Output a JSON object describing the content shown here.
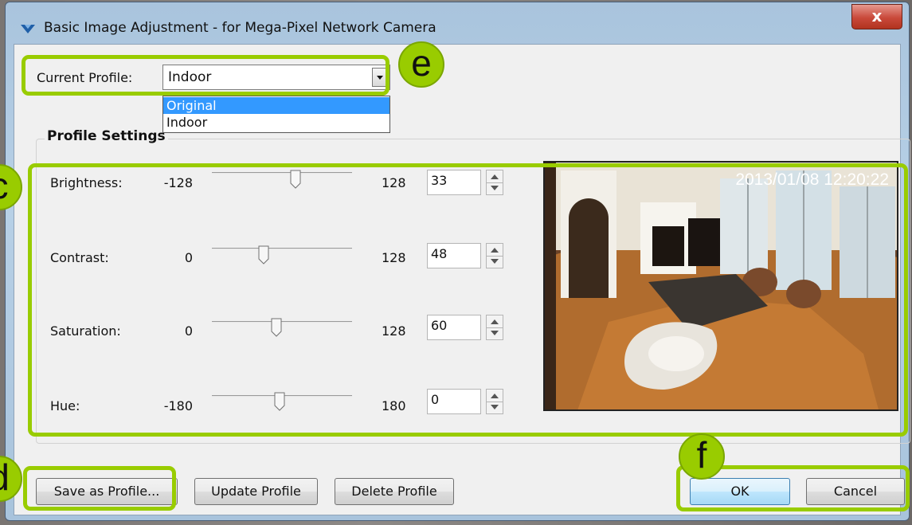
{
  "window": {
    "title": "Basic Image Adjustment - for Mega-Pixel Network Camera",
    "close_label": "x"
  },
  "profile": {
    "label": "Current Profile:",
    "selected": "Indoor",
    "options": [
      "Original",
      "Indoor"
    ],
    "highlighted_option": "Original"
  },
  "settings": {
    "title": "Profile Settings",
    "sliders": [
      {
        "label": "Brightness:",
        "min": "-128",
        "max": "128",
        "value": "33"
      },
      {
        "label": "Contrast:",
        "min": "0",
        "max": "128",
        "value": "48"
      },
      {
        "label": "Saturation:",
        "min": "0",
        "max": "128",
        "value": "60"
      },
      {
        "label": "Hue:",
        "min": "-180",
        "max": "180",
        "value": "0"
      }
    ]
  },
  "preview": {
    "timestamp": "2013/01/08 12:20:22"
  },
  "buttons": {
    "save": "Save as Profile...",
    "update": "Update Profile",
    "delete": "Delete Profile",
    "ok": "OK",
    "cancel": "Cancel"
  },
  "callouts": {
    "c": "c",
    "d": "d",
    "e": "e",
    "f": "f"
  },
  "colors": {
    "callout": "#99cc00",
    "selection": "#3399ff",
    "close_button": "#c9493a"
  }
}
